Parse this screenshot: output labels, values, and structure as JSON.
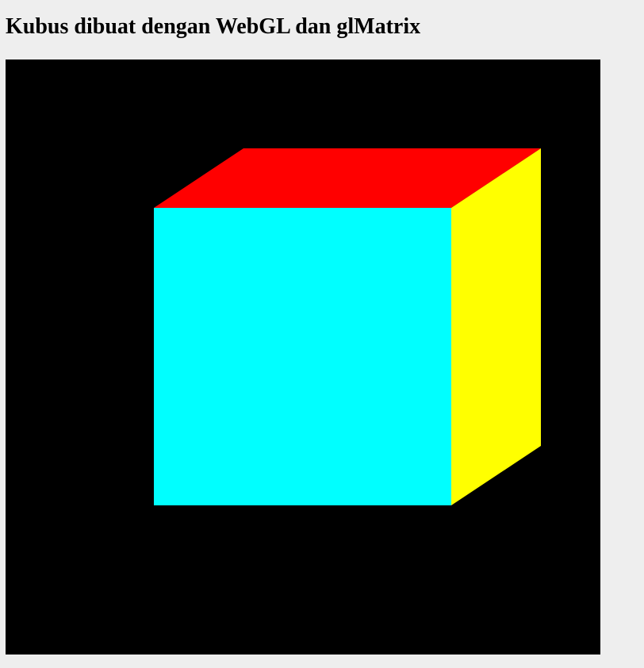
{
  "page": {
    "title": "Kubus dibuat dengan WebGL dan glMatrix"
  },
  "canvas": {
    "background_color": "#000000",
    "cube": {
      "front_face_color": "#00ffff",
      "top_face_color": "#ff0000",
      "right_face_color": "#ffff00"
    }
  }
}
